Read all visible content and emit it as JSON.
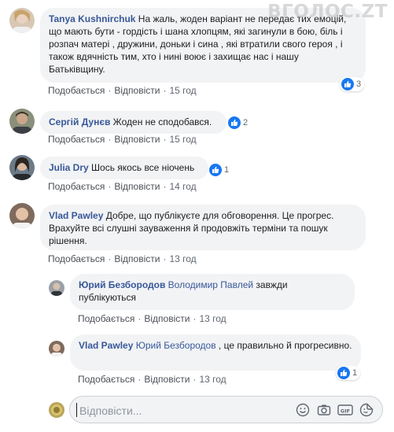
{
  "watermark": "ВГОЛОС.ZT",
  "comments": [
    {
      "author": "Tanya Kushnirchuk",
      "text": " На жаль, жоден варіант не передає тих емоцій, що мають бути - гордість і шана хлопцям, які загинули в бою, біль і розпач матері , дружини, доньки і сина , які втратили свого героя , і також вдячність тим, хто і нині воює і захищає нас і нашу Батьківщину.",
      "like": "Подобається",
      "reply": "Відповісти",
      "time": "15 год",
      "reactions": "3"
    },
    {
      "author": "Сергій Дунєв",
      "text": " Жоден не сподобався.",
      "like": "Подобається",
      "reply": "Відповісти",
      "time": "15 год",
      "reactions": "2"
    },
    {
      "author": "Julia Dry",
      "text": " Шось якось все ніочень",
      "like": "Подобається",
      "reply": "Відповісти",
      "time": "14 год",
      "reactions": "1"
    },
    {
      "author": "Vlad Pawley",
      "text": " Добре, що публікуєте для обговорення. Це прогрес. Врахуйте всі слушні зауваження й продовжіть терміни та пошук рішення.",
      "like": "Подобається",
      "reply": "Відповісти",
      "time": "13 год"
    }
  ],
  "replies": [
    {
      "author": "Юрий Безбородов",
      "mention": "Володимир Павлей",
      "text": " завжди публікуються",
      "like": "Подобається",
      "reply": "Відповісти",
      "time": "13 год"
    },
    {
      "author": "Vlad Pawley",
      "mention": "Юрий Безбородов",
      "text": " , це правильно й прогресивно.",
      "like": "Подобається",
      "reply": "Відповісти",
      "time": "13 год",
      "reactions": "1"
    }
  ],
  "reply_box": {
    "placeholder": "Відповісти..."
  },
  "icons": [
    "like-icon",
    "emoji-icon",
    "camera-icon",
    "gif-icon",
    "sticker-icon"
  ],
  "colors": {
    "link": "#385898",
    "bubble": "#f2f3f5",
    "like_blue": "#1877f2",
    "meta": "#606770"
  }
}
